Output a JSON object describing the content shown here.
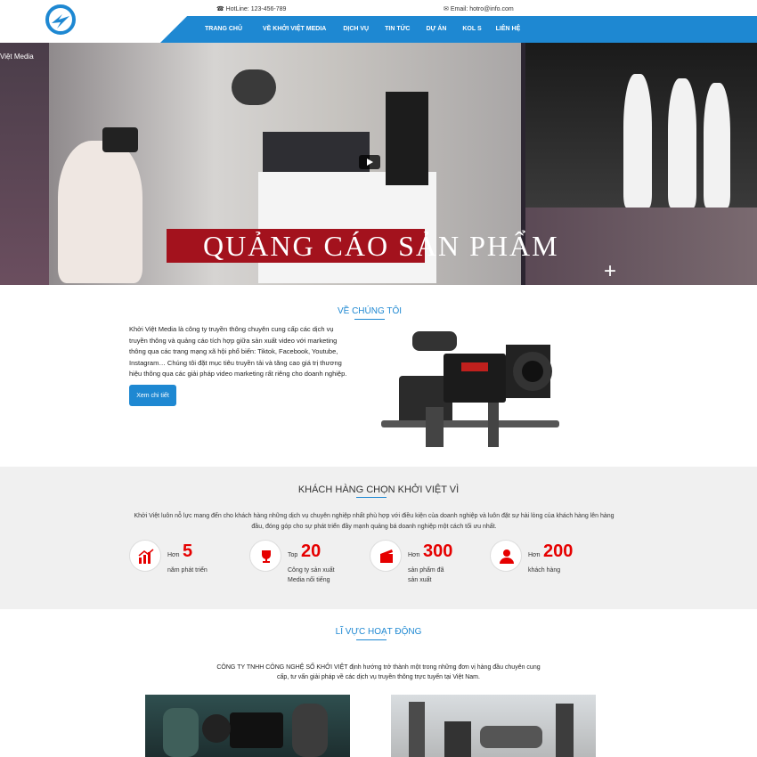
{
  "header": {
    "hotline": "HotLine: 123-456-789",
    "email": "Email: hotro@info.com",
    "nav": [
      "TRANG CHỦ",
      "VỀ KHỞI VIỆT MEDIA",
      "DỊCH VỤ",
      "TIN TỨC",
      "DỰ ÁN",
      "KOL S",
      "LIÊN HỆ"
    ]
  },
  "hero": {
    "label": "Việt Media",
    "caption": "QUẢNG CÁO SẢN PHẨM"
  },
  "about": {
    "title": "VỀ CHÚNG TÔI",
    "text": "Khởi Việt Media là công ty truyền thông chuyên cung cấp các dịch vụ truyền thông và quảng cáo tích hợp giữa sản xuất video với marketing thông qua các trang mạng xã hội phổ biến: Tiktok, Facebook, Youtube, Instagram… Chúng tôi đặt mục tiêu truyền tải và tăng cao giá trị thương hiệu thông qua các giải pháp video marketing rất riêng cho doanh nghiệp.",
    "button": "Xem chi tiết"
  },
  "why": {
    "title": "KHÁCH HÀNG CHỌN KHỞI VIỆT VÌ",
    "text": "Khởi Việt luôn nỗ lực mang đến cho khách hàng những dịch vụ chuyên nghiệp nhất phù hợp với điều kiện của doanh nghiệp và luôn đặt sự hài lòng của khách hàng lên hàng đầu, đóng góp cho sự phát triển đầy mạnh quảng bá doanh nghiệp một cách tối ưu nhất.",
    "stats": [
      {
        "pre": "Hơn",
        "num": "5",
        "desc1": "năm phát triển",
        "desc2": ""
      },
      {
        "pre": "Top",
        "num": "20",
        "desc1": "Công ty sản xuất",
        "desc2": "Media nổi tiếng"
      },
      {
        "pre": "Hơn",
        "num": "300",
        "desc1": "sản phẩm đã",
        "desc2": "sản xuất"
      },
      {
        "pre": "Hơn",
        "num": "200",
        "desc1": "khách hàng",
        "desc2": ""
      }
    ],
    "colors": {
      "accent": "#1e88d2",
      "number": "#e60000"
    }
  },
  "fields": {
    "title": "LĨ VỰC HOẠT ĐỘNG",
    "text": "CÔNG TY TNHH CÔNG NGHỆ SỐ KHỞI VIỆT định hướng trở thành một trong những đơn vị hàng đầu chuyên cung cấp, tư vấn giải pháp về các dịch vụ truyền thông trực tuyến tại Việt Nam."
  }
}
